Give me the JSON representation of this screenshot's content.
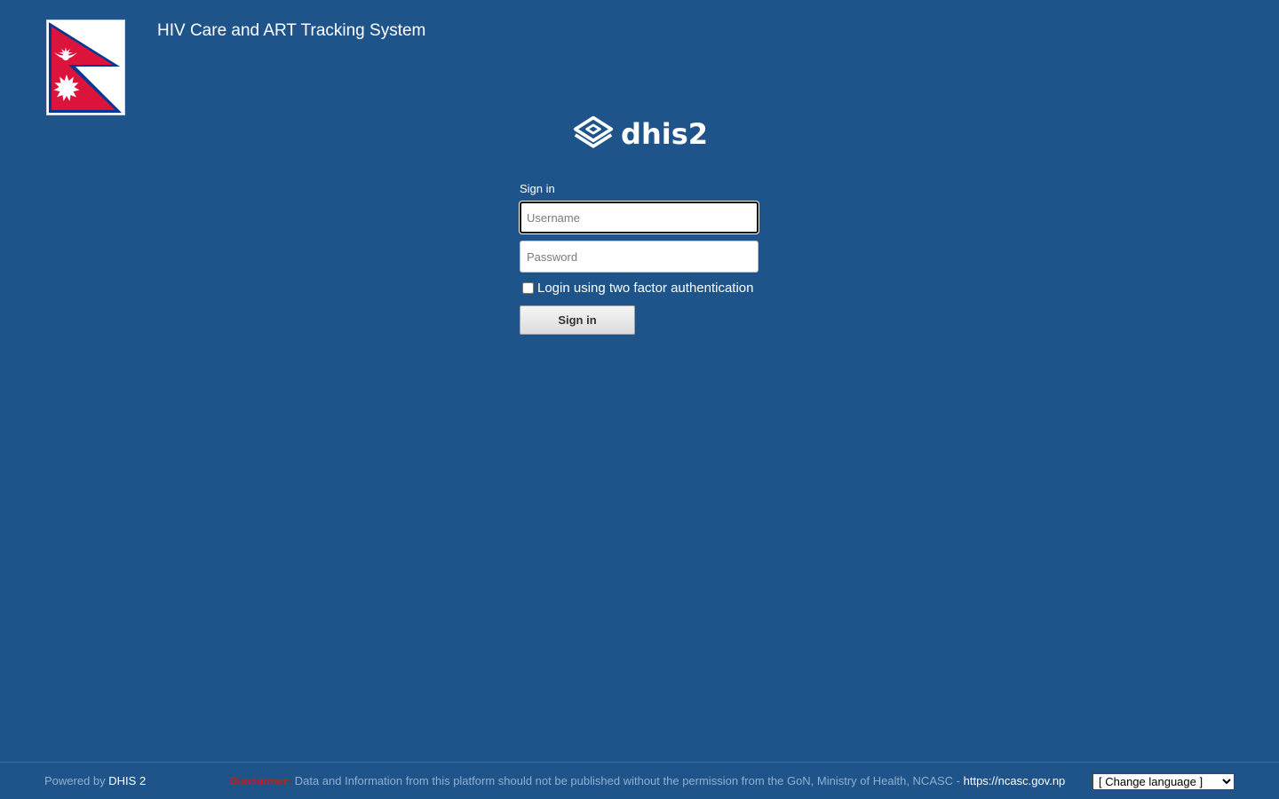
{
  "header": {
    "title": "HIV Care and ART Tracking System"
  },
  "brand": {
    "logo_text": "dhis2"
  },
  "login": {
    "heading": "Sign in",
    "username": {
      "value": "",
      "placeholder": "Username"
    },
    "password": {
      "value": "",
      "placeholder": "Password"
    },
    "two_factor_label": "Login using two factor authentication",
    "two_factor_checked": false,
    "submit_label": "Sign in"
  },
  "footer": {
    "powered_prefix": "Powered by",
    "powered_link": "DHIS 2",
    "disclaimer_label": "Disclaimer:",
    "disclaimer_text": "Data and Information from this platform should not be published without the permission from the GoN, Ministry of Health, NCASC -",
    "disclaimer_link": "https://ncasc.gov.np",
    "language_selected": "[ Change language ]"
  },
  "colors": {
    "background": "#1f548a",
    "flag_red": "#dc143c",
    "flag_blue": "#003893",
    "disclaimer_red": "#c21d1d"
  }
}
